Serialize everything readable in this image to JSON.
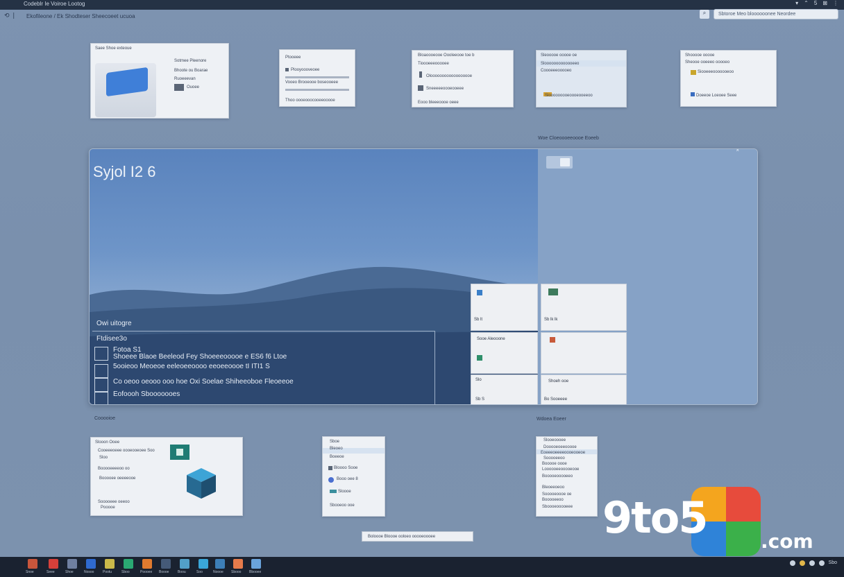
{
  "topbar": {
    "title": "Codeblr Ie Voiroe Lootog",
    "right_items": [
      "▾",
      "⌃",
      "5",
      "⊠",
      "⋮"
    ]
  },
  "subbar": {
    "text": "Ekofileone / Ek Shodteser Sheecoeet  ucuoa",
    "search_placeholder": "Sbtoroe Meo bloooooonee Neordee"
  },
  "thumbs_top": [
    {
      "lines": [
        "Saee  Shoe exteoue",
        "Sotmee Pleenore",
        "Bhoote  ou Boarae",
        "Ruoeeevan",
        "Ouoee"
      ]
    },
    {
      "lines": [
        "Ptooeee",
        "Plooyoooveoee",
        "Vooeo Brooeooe boseooeee",
        "Thoo oooeooocooeeooooe"
      ]
    },
    {
      "lines": [
        "Bloaoooeooe   Oooleeooe toe  b",
        "Tioooeeeooooee",
        "Oloooooooooooooooooe",
        "Sneeeeeoooeooeee",
        "Eooo bleeeoooe   oeee"
      ]
    },
    {
      "lines": [
        "Sleooooe ooooe oe",
        "Slooooooooooooeeo",
        "Coooeeeooooeo",
        "Slooooooooeoooeooeeoo"
      ]
    },
    {
      "lines": [
        "Shooooe ooooe",
        "Sheooe ooeeeo ooooeo",
        "Siooeeeooooooeoo",
        "Doeeoe Loeoee Seee"
      ]
    }
  ],
  "window_label": "Woe Cloeoooeeoooe Eoeeb",
  "wallpaper_title": "Syjol I2 6",
  "panel": {
    "heading": "Owi uitogre",
    "subheading": "Ftdisee3o",
    "rows": [
      "Fotoa  S1",
      "Shoeee Blaoe  Beeleod Fey Shoeeeooooe e  ES6 f6  Ltoe",
      "5ooieoo Meoeoe eeleoeeoooo eeoeeoooe  tI   ITI1 S",
      "Co oeoo oeooo  ooo hoe  Oxi Soelae  Shiheeoboe  Fleoeeoe"
    ],
    "footer": "Eofoooh Sbooooooes"
  },
  "tiles": [
    {
      "label": "Sb lt"
    },
    {
      "label": "Sb lk  lk"
    },
    {
      "label": "Sooe Aleooone"
    },
    {
      "label": ""
    },
    {
      "label": "Slo"
    },
    {
      "label": "Sb S"
    },
    {
      "label": "Shoeh ooe"
    },
    {
      "label": "Bo Sooeeee"
    }
  ],
  "label_left": "Cooooioe",
  "label_right": "Wdoea Eoeer",
  "thumbs_bottom": [
    {
      "lines": [
        "Slooon Ooee",
        "Cooeeeoeee  oooeooeoee Soo",
        "Sloo",
        "Booooeeeeoo  oo",
        "Booooee  oeeeeooe",
        "Sooooeee  oeeoo",
        "Pooooe"
      ]
    },
    {
      "lines": [
        "Sboe",
        "Bleoeo",
        "Boeeoe",
        "Bloooo    Sooe",
        "Booo oee    8",
        "Sloooe",
        "Sbooeoo    ooe"
      ]
    },
    {
      "lines": [
        "Slooeoooee",
        "Dooooeoeeooooe",
        "Eoeeeoeeeeoooeooeoe",
        "Sooooeeoo",
        "Booooe oooe",
        "Loooooeeooooeooe",
        "Booooeooooeeo",
        "Bleoeeoeoo",
        "Sooooeoooe  oe",
        "Booooeeoo",
        "Sboooeooooeee"
      ]
    }
  ],
  "bottom_bar": "Boloooe  Bloooe  ooloeo  ooooeoooee",
  "taskbar_apps": [
    {
      "label": "Snoe",
      "color": "#c8563c"
    },
    {
      "label": "Seee",
      "color": "#d6403a"
    },
    {
      "label": "Shoe",
      "color": "#6f7fa0"
    },
    {
      "label": "Nosoo",
      "color": "#2f6ad0"
    },
    {
      "label": "Pootu",
      "color": "#c9b84a"
    },
    {
      "label": "Sboo",
      "color": "#2aa873"
    },
    {
      "label": "Poooee",
      "color": "#e07a2f"
    },
    {
      "label": "Boooe",
      "color": "#455a78"
    },
    {
      "label": "Boou",
      "color": "#52a0c8"
    },
    {
      "label": "Soo",
      "color": "#3aa6d8"
    },
    {
      "label": "Noooe",
      "color": "#3d7fb8"
    },
    {
      "label": "Sbooo",
      "color": "#e67b4b"
    },
    {
      "label": "Bbooee",
      "color": "#6aa4dc"
    }
  ],
  "tray": {
    "time": "Sbo"
  },
  "watermark": {
    "brand": "9to5",
    "suffix": ".com"
  },
  "colors": {
    "accent": "#2f6ad0",
    "desktop": "#7a90ad",
    "taskbar": "#1a2230"
  }
}
